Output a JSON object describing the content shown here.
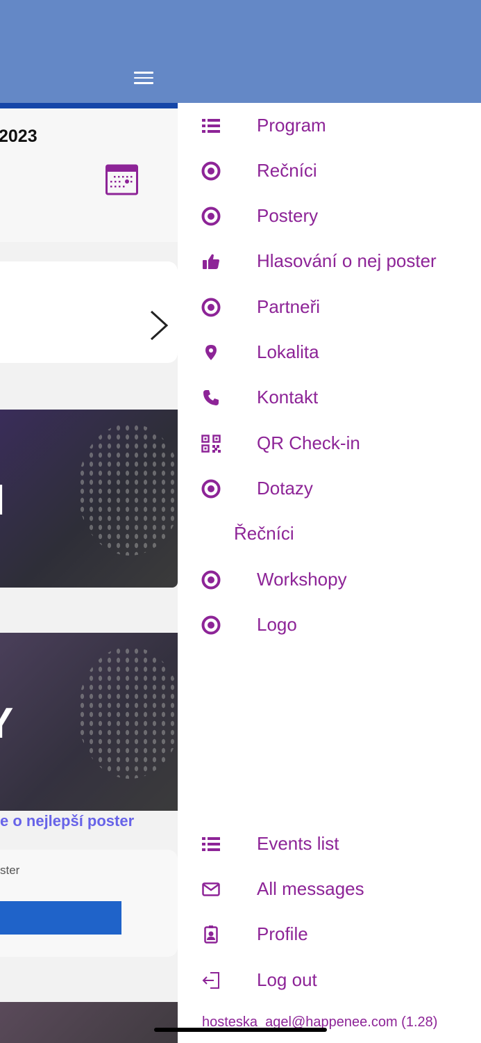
{
  "header": {
    "menu_icon": "hamburger-icon",
    "color": "#6488c6"
  },
  "background": {
    "event_date": "2023",
    "calendar_icon": "calendar-icon",
    "next_icon": "chevron-right-icon",
    "banner1_text": "I",
    "banner2_text": "Y",
    "vote_link": "e o nejlepší poster",
    "vote_subtext": "ster"
  },
  "menu": {
    "accent_color": "#8d2497",
    "items": [
      {
        "label": "Program",
        "icon": "list-icon"
      },
      {
        "label": "Rečníci",
        "icon": "target-icon"
      },
      {
        "label": "Postery",
        "icon": "target-icon"
      },
      {
        "label": "Hlasování o nej poster",
        "icon": "thumbs-up-icon"
      },
      {
        "label": "Partneři",
        "icon": "target-icon"
      },
      {
        "label": "Lokalita",
        "icon": "map-pin-icon"
      },
      {
        "label": "Kontakt",
        "icon": "phone-icon"
      },
      {
        "label": "QR Check-in",
        "icon": "qr-code-icon"
      },
      {
        "label": "Dotazy",
        "icon": "target-icon"
      },
      {
        "label": "Řečníci"
      },
      {
        "label": "Workshopy",
        "icon": "target-icon"
      },
      {
        "label": "Logo",
        "icon": "target-icon"
      }
    ],
    "bottom_items": [
      {
        "label": "Events list",
        "icon": "list-icon"
      },
      {
        "label": "All messages",
        "icon": "envelope-icon"
      },
      {
        "label": "Profile",
        "icon": "id-badge-icon"
      },
      {
        "label": "Log out",
        "icon": "logout-icon"
      }
    ],
    "footer_email": "hosteska_agel@happenee.com (1.28)"
  }
}
